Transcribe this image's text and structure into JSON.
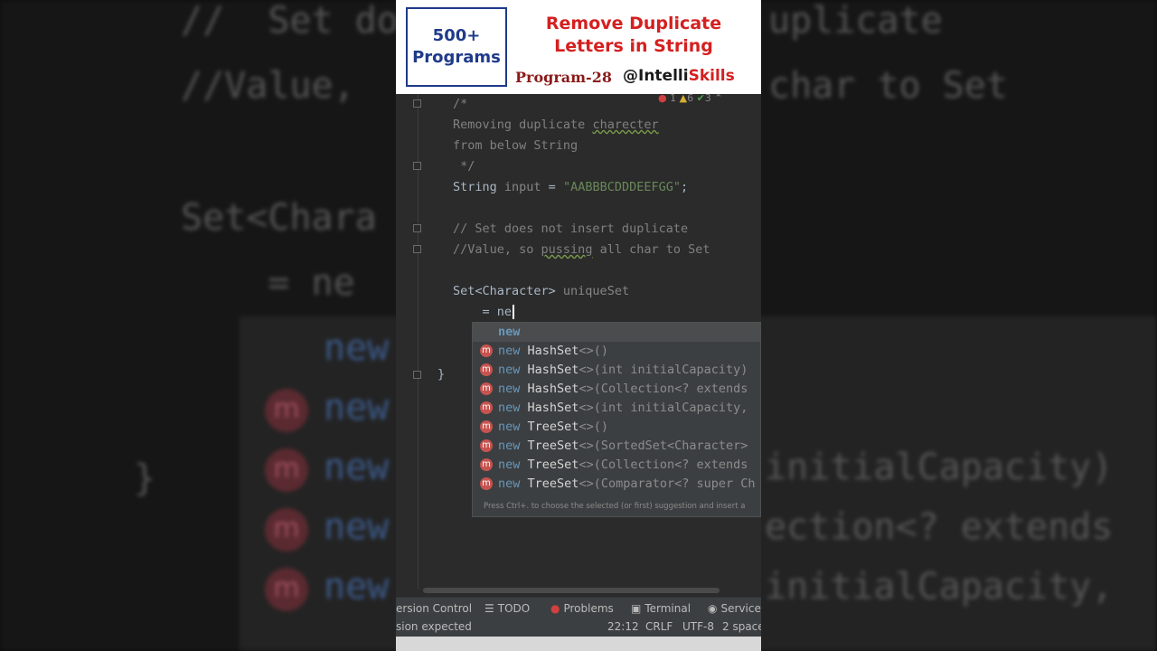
{
  "banner": {
    "badge_line1": "500+",
    "badge_line2": "Programs",
    "title_line1": "Remove Duplicate",
    "title_line2": "Letters in String",
    "program": "Program-28",
    "handle_prefix": "@Intelli",
    "handle_suffix": "Skills"
  },
  "inspections": {
    "errors": "1",
    "warnings": "6",
    "weak_warnings": "3"
  },
  "code": {
    "line1": "/*",
    "line2_pre": "Removing duplicate ",
    "line2_word": "charecter",
    "line3": "from below String",
    "line4": " */",
    "line5_type": "String ",
    "line5_var": "input",
    "line5_eq": " = ",
    "line5_str": "\"AABBBCDDDEEFGG\"",
    "line5_end": ";",
    "line7": "// Set does not insert duplicate",
    "line8_pre": "//Value, so ",
    "line8_word": "pussing",
    "line8_post": " all char to Set",
    "line10_type": "Set<Character> ",
    "line10_var": "uniqueSet",
    "line11": "    = ne",
    "line14": "}"
  },
  "completion": {
    "first": "new",
    "items": [
      {
        "kw": "new",
        "cls": "HashSet",
        "rest": "<>()"
      },
      {
        "kw": "new",
        "cls": "HashSet",
        "rest": "<>(int initialCapacity)"
      },
      {
        "kw": "new",
        "cls": "HashSet",
        "rest": "<>(Collection<? extends"
      },
      {
        "kw": "new",
        "cls": "HashSet",
        "rest": "<>(int initialCapacity,"
      },
      {
        "kw": "new",
        "cls": "TreeSet",
        "rest": "<>()"
      },
      {
        "kw": "new",
        "cls": "TreeSet",
        "rest": "<>(SortedSet<Character>"
      },
      {
        "kw": "new",
        "cls": "TreeSet",
        "rest": "<>(Collection<? extends"
      },
      {
        "kw": "new",
        "cls": "TreeSet",
        "rest": "<>(Comparator<? super Ch"
      }
    ],
    "icon_letter": "m",
    "hint": "Press Ctrl+. to choose the selected (or first) suggestion and insert a"
  },
  "toolbar": {
    "version_control": "ersion Control",
    "todo": "TODO",
    "problems": "Problems",
    "terminal": "Terminal",
    "services": "Services"
  },
  "status": {
    "message": "sion expected",
    "position": "22:12",
    "line_sep": "CRLF",
    "encoding": "UTF-8",
    "indent": "2 space"
  },
  "background": {
    "l1": "//  Set do",
    "l1r": "uplicate",
    "l2": "//Value,",
    "l2r": "char to Set",
    "l3": "Set<Chara",
    "l4": "    = ne",
    "kw": "new",
    "r1": "initialCapacity)",
    "r2": "ection<? extends",
    "r3": "initialCapacity,",
    "brace": "}"
  }
}
